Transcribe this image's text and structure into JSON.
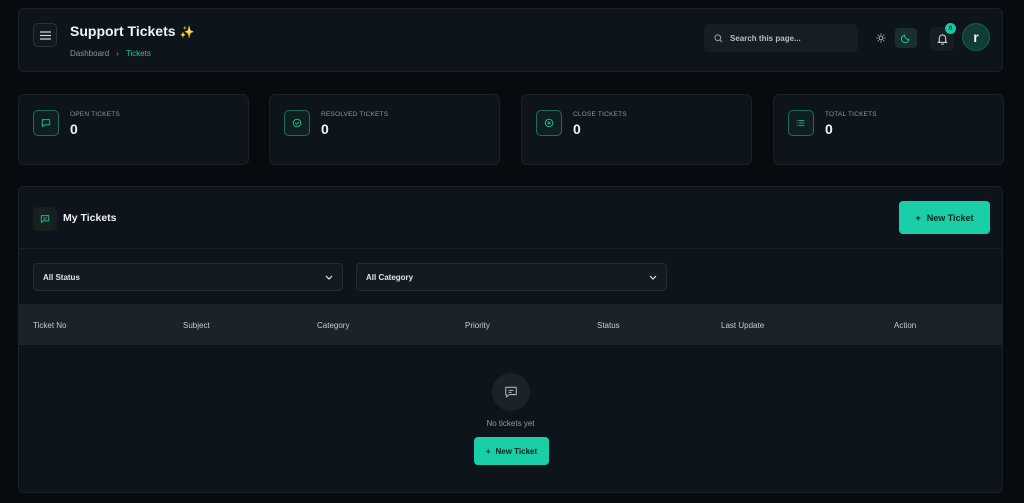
{
  "header": {
    "title": "Support Tickets",
    "title_emoji": "✨",
    "breadcrumb": {
      "root": "Dashboard",
      "separator": "›",
      "current": "Tickets"
    },
    "search_placeholder": "Search this page...",
    "notification_count": "0",
    "avatar_initial": "r"
  },
  "stats": [
    {
      "label": "OPEN TICKETS",
      "value": "0",
      "icon": "message-square-icon"
    },
    {
      "label": "RESOLVED TICKETS",
      "value": "0",
      "icon": "check-circle-icon"
    },
    {
      "label": "CLOSE TICKETS",
      "value": "0",
      "icon": "x-circle-icon"
    },
    {
      "label": "TOTAL TICKETS",
      "value": "0",
      "icon": "list-icon"
    }
  ],
  "main": {
    "title": "My Tickets",
    "new_ticket_label": "New Ticket",
    "filters": {
      "status": "All Status",
      "category": "All Category"
    },
    "columns": [
      "Ticket No",
      "Subject",
      "Category",
      "Priority",
      "Status",
      "Last Update",
      "Action"
    ],
    "empty": {
      "text": "No tickets yet",
      "button_label": "New Ticket"
    }
  },
  "colors": {
    "accent": "#19cfa7",
    "background": "#070b10",
    "card": "#0e141b"
  }
}
